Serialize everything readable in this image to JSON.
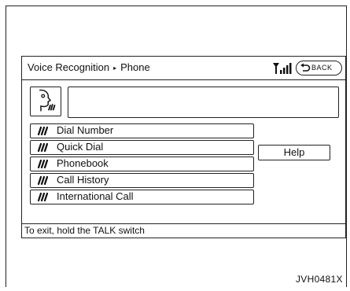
{
  "header": {
    "breadcrumb_root": "Voice Recognition",
    "breadcrumb_separator": "▸",
    "breadcrumb_current": "Phone",
    "signal_icon": "signal-strength-icon",
    "back_label": "BACK"
  },
  "prompt": {
    "icon": "voice-face-icon",
    "value": ""
  },
  "menu": {
    "items": [
      {
        "label": "Dial Number"
      },
      {
        "label": "Quick Dial"
      },
      {
        "label": "Phonebook"
      },
      {
        "label": "Call History"
      },
      {
        "label": "International Call"
      }
    ],
    "item_icon": "voice-command-icon"
  },
  "help_label": "Help",
  "status_text": "To exit, hold the TALK switch",
  "figure_code": "JVH0481X"
}
